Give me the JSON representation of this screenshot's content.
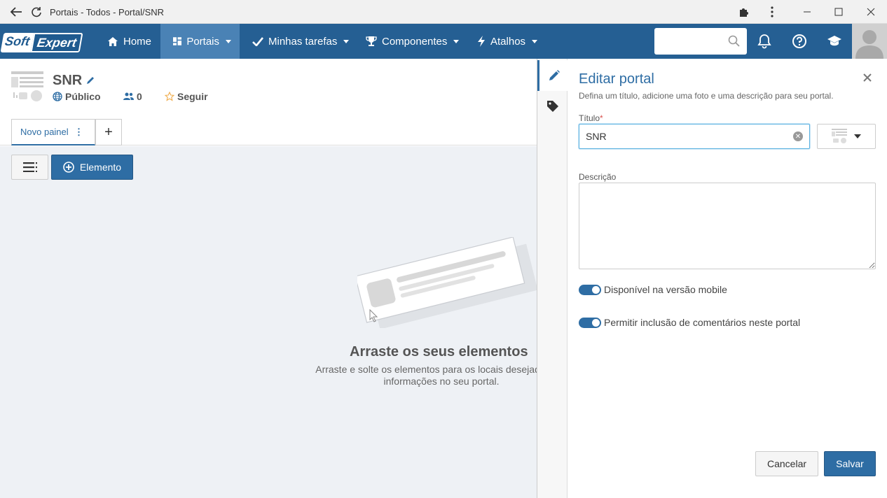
{
  "browser": {
    "title": "Portais - Todos - Portal/SNR"
  },
  "nav": {
    "logo_soft": "Soft",
    "logo_expert": "Expert",
    "items": [
      {
        "label": "Home"
      },
      {
        "label": "Portais"
      },
      {
        "label": "Minhas tarefas"
      },
      {
        "label": "Componentes"
      },
      {
        "label": "Atalhos"
      }
    ],
    "search_placeholder": ""
  },
  "portal": {
    "title": "SNR",
    "visibility": "Público",
    "members_count": "0",
    "follow_label": "Seguir"
  },
  "tabs": {
    "panel_label": "Novo painel",
    "add_label": "+"
  },
  "toolbar": {
    "element_button": "Elemento"
  },
  "empty_state": {
    "title": "Arraste os seus elementos",
    "line1": "Arraste e solte os elementos para os locais desejados par",
    "line2": "informações no seu portal."
  },
  "edit_panel": {
    "title": "Editar portal",
    "subtitle": "Defina um título, adicione uma foto e uma descrição para seu portal.",
    "title_label": "Título",
    "required_mark": "*",
    "title_value": "SNR",
    "description_label": "Descrição",
    "description_value": "",
    "toggle_mobile_label": "Disponível na versão mobile",
    "toggle_mobile_on": true,
    "toggle_comments_label": "Permitir inclusão de comentários neste portal",
    "toggle_comments_on": true,
    "cancel_label": "Cancelar",
    "save_label": "Salvar"
  },
  "colors": {
    "nav_bg": "#255f93",
    "nav_active": "#4a82b5",
    "primary": "#2e6da4",
    "workspace_bg": "#eef1f5"
  }
}
